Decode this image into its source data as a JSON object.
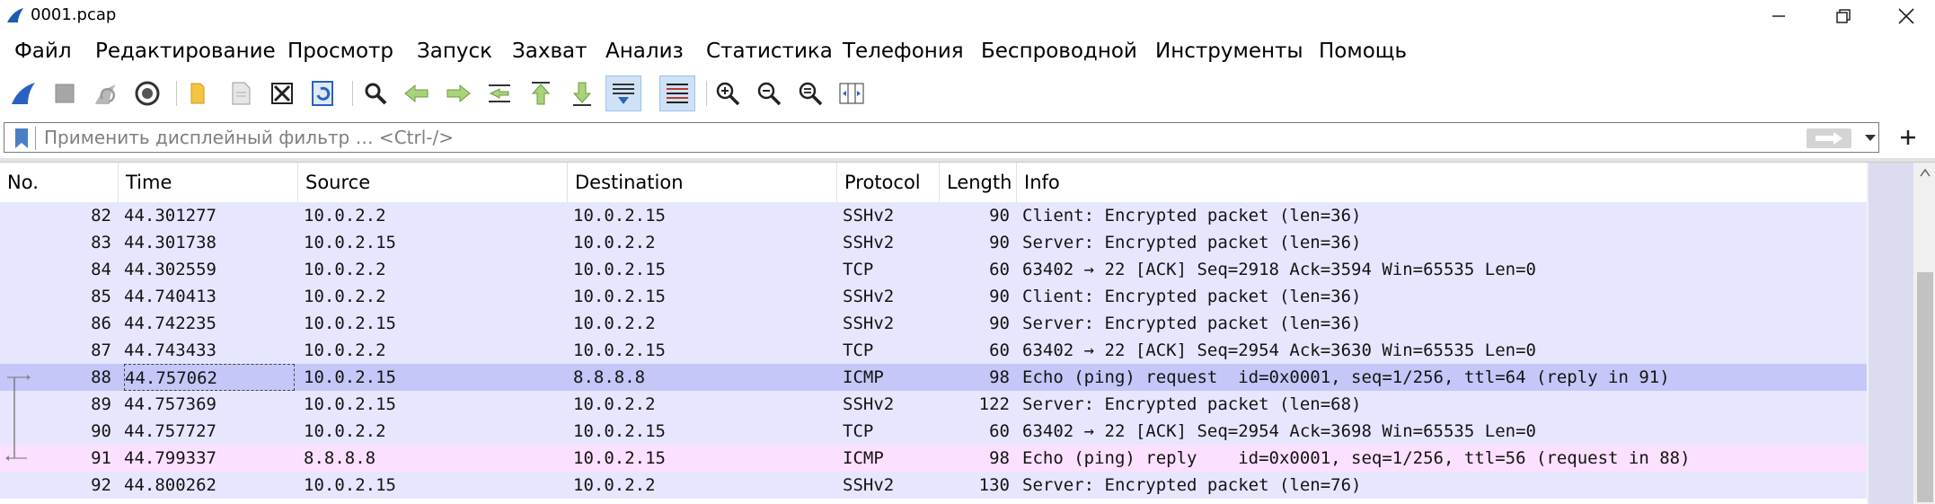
{
  "window": {
    "title": "0001.pcap",
    "accent": "#1a5bb3"
  },
  "menu": [
    {
      "label": "Файл"
    },
    {
      "label": "Редактирование"
    },
    {
      "label": "Просмотр"
    },
    {
      "label": "Запуск"
    },
    {
      "label": "Захват"
    },
    {
      "label": "Анализ"
    },
    {
      "label": "Статистика"
    },
    {
      "label": "Телефония"
    },
    {
      "label": "Беспроводной"
    },
    {
      "label": "Инструменты"
    },
    {
      "label": "Помощь"
    }
  ],
  "toolbar": {
    "buttons": [
      {
        "icon": "shark-fin-start-icon"
      },
      {
        "icon": "stop-capture-icon"
      },
      {
        "icon": "restart-capture-icon"
      },
      {
        "icon": "capture-options-gear-icon"
      },
      {
        "icon": "open-file-folder-icon"
      },
      {
        "icon": "save-file-icon"
      },
      {
        "icon": "close-file-icon"
      },
      {
        "icon": "reload-file-icon"
      },
      {
        "icon": "find-packet-magnifier-icon"
      },
      {
        "icon": "go-back-arrow-icon"
      },
      {
        "icon": "go-forward-arrow-icon"
      },
      {
        "icon": "go-to-packet-icon"
      },
      {
        "icon": "go-to-first-packet-icon"
      },
      {
        "icon": "go-to-last-packet-icon"
      },
      {
        "icon": "autoscroll-icon"
      },
      {
        "icon": "colorize-icon"
      },
      {
        "icon": "zoom-in-icon"
      },
      {
        "icon": "zoom-out-icon"
      },
      {
        "icon": "zoom-normal-icon"
      },
      {
        "icon": "resize-columns-icon"
      }
    ]
  },
  "filter": {
    "placeholder": "Применить дисплейный фильтр … <Ctrl-/>",
    "value": ""
  },
  "columns": {
    "no": "No.",
    "time": "Time",
    "source": "Source",
    "destination": "Destination",
    "protocol": "Protocol",
    "length": "Length",
    "info": "Info"
  },
  "row_colors": {
    "ssh_tcp": "#e7e6ff",
    "icmp_request_selected": "#c5c7f8",
    "icmp_reply": "#fce0ff"
  },
  "packets": [
    {
      "no": "82",
      "time": "44.301277",
      "source": "10.0.2.2",
      "destination": "10.0.2.15",
      "protocol": "SSHv2",
      "length": "90",
      "info": "Client: Encrypted packet (len=36)",
      "color": "ssh_tcp"
    },
    {
      "no": "83",
      "time": "44.301738",
      "source": "10.0.2.15",
      "destination": "10.0.2.2",
      "protocol": "SSHv2",
      "length": "90",
      "info": "Server: Encrypted packet (len=36)",
      "color": "ssh_tcp"
    },
    {
      "no": "84",
      "time": "44.302559",
      "source": "10.0.2.2",
      "destination": "10.0.2.15",
      "protocol": "TCP",
      "length": "60",
      "info": "63402 → 22 [ACK] Seq=2918 Ack=3594 Win=65535 Len=0",
      "color": "ssh_tcp"
    },
    {
      "no": "85",
      "time": "44.740413",
      "source": "10.0.2.2",
      "destination": "10.0.2.15",
      "protocol": "SSHv2",
      "length": "90",
      "info": "Client: Encrypted packet (len=36)",
      "color": "ssh_tcp"
    },
    {
      "no": "86",
      "time": "44.742235",
      "source": "10.0.2.15",
      "destination": "10.0.2.2",
      "protocol": "SSHv2",
      "length": "90",
      "info": "Server: Encrypted packet (len=36)",
      "color": "ssh_tcp"
    },
    {
      "no": "87",
      "time": "44.743433",
      "source": "10.0.2.2",
      "destination": "10.0.2.15",
      "protocol": "TCP",
      "length": "60",
      "info": "63402 → 22 [ACK] Seq=2954 Ack=3630 Win=65535 Len=0",
      "color": "ssh_tcp"
    },
    {
      "no": "88",
      "time": "44.757062",
      "source": "10.0.2.15",
      "destination": "8.8.8.8",
      "protocol": "ICMP",
      "length": "98",
      "info": "Echo (ping) request  id=0x0001, seq=1/256, ttl=64 (reply in 91)",
      "color": "icmp_request_selected",
      "selected": true,
      "related": "request"
    },
    {
      "no": "89",
      "time": "44.757369",
      "source": "10.0.2.15",
      "destination": "10.0.2.2",
      "protocol": "SSHv2",
      "length": "122",
      "info": "Server: Encrypted packet (len=68)",
      "color": "ssh_tcp"
    },
    {
      "no": "90",
      "time": "44.757727",
      "source": "10.0.2.2",
      "destination": "10.0.2.15",
      "protocol": "TCP",
      "length": "60",
      "info": "63402 → 22 [ACK] Seq=2954 Ack=3698 Win=65535 Len=0",
      "color": "ssh_tcp"
    },
    {
      "no": "91",
      "time": "44.799337",
      "source": "8.8.8.8",
      "destination": "10.0.2.15",
      "protocol": "ICMP",
      "length": "98",
      "info": "Echo (ping) reply    id=0x0001, seq=1/256, ttl=56 (request in 88)",
      "color": "icmp_reply",
      "related": "reply"
    },
    {
      "no": "92",
      "time": "44.800262",
      "source": "10.0.2.15",
      "destination": "10.0.2.2",
      "protocol": "SSHv2",
      "length": "130",
      "info": "Server: Encrypted packet (len=76)",
      "color": "ssh_tcp"
    }
  ]
}
